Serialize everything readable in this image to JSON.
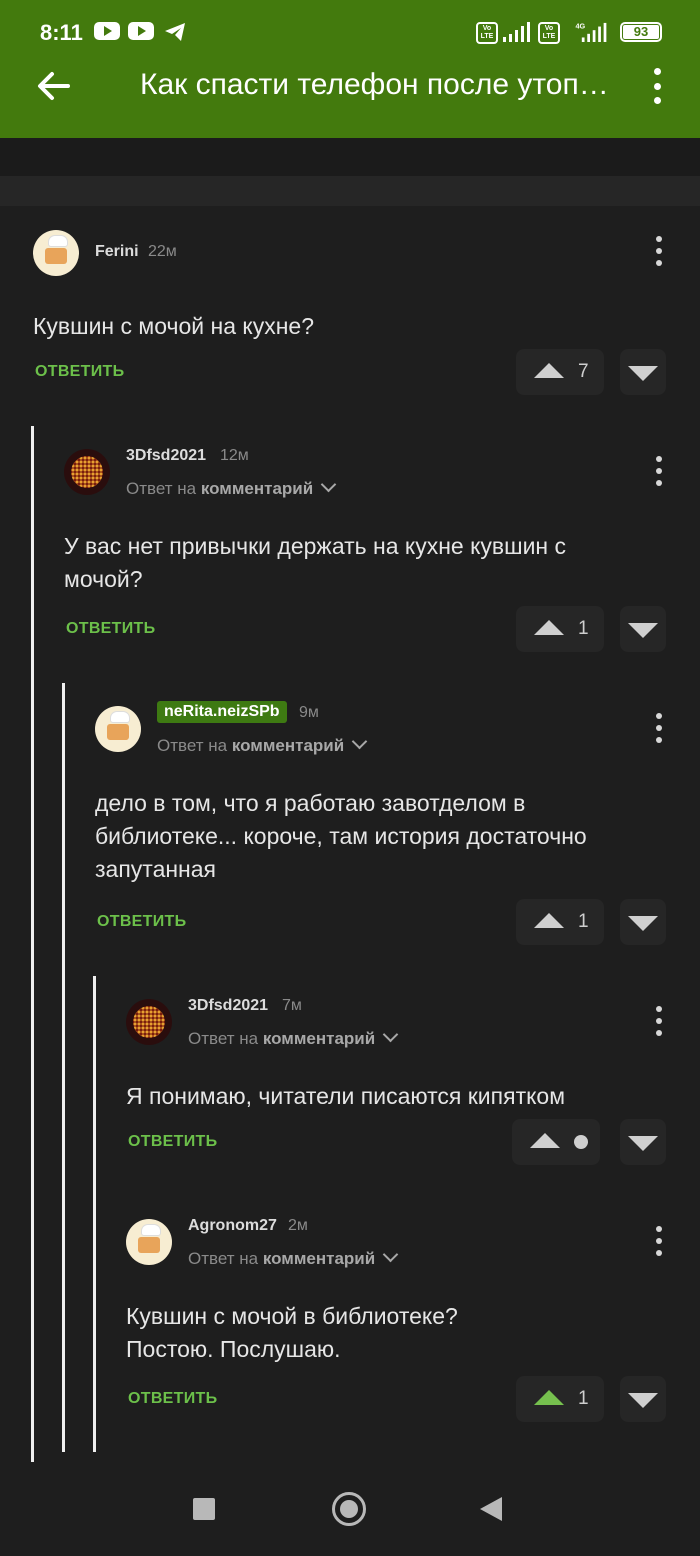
{
  "status_bar": {
    "time": "8:11",
    "icons": [
      "youtube-icon",
      "youtube-icon",
      "telegram-icon",
      "volte-icon",
      "signal-icon",
      "volte-icon",
      "signal-4g-icon"
    ],
    "volte_label": "Vo LTE",
    "network_label": "4G",
    "battery": "93"
  },
  "header": {
    "title": "Как спасти телефон после утопления",
    "back_icon": "arrow-left-icon",
    "menu_icon": "more-vertical-icon",
    "color": "#437a0d"
  },
  "comments": [
    {
      "author": "Ferini",
      "age": "22м",
      "text": "Кувшин с мочой на кухне?",
      "answer": "ОТВЕТИТЬ",
      "rating": "7",
      "avatar": "chef-avatar"
    },
    {
      "author": "3Dfsd2021",
      "age": "12м",
      "reply_prefix": "Ответ на",
      "reply_target": "комментарий",
      "text": "У вас нет привычки держать на кухне кувшин с мочой?",
      "answer": "ОТВЕТИТЬ",
      "rating": "1",
      "avatar": "grid-avatar"
    },
    {
      "author": "neRita.neizSPb",
      "age": "9м",
      "reply_prefix": "Ответ на",
      "reply_target": "комментарий",
      "text": "дело в том, что я работаю завотделом в библиотеке... короче, там история достаточно запутанная",
      "answer": "ОТВЕТИТЬ",
      "rating": "1",
      "avatar": "chef-avatar",
      "author_badge": true
    },
    {
      "author": "3Dfsd2021",
      "age": "7м",
      "reply_prefix": "Ответ на",
      "reply_target": "комментарий",
      "text": "Я понимаю, читатели писаются кипятком",
      "answer": "ОТВЕТИТЬ",
      "rating": "",
      "avatar": "grid-avatar"
    },
    {
      "author": "Agronom27",
      "age": "2м",
      "reply_prefix": "Ответ на",
      "reply_target": "комментарий",
      "text": "Кувшин с мочой в библиотеке?\nПостою. Послушаю.",
      "answer": "ОТВЕТИТЬ",
      "rating": "1",
      "avatar": "chef-avatar",
      "upvoted": true
    }
  ],
  "colors": {
    "accent_green": "#6cc04a",
    "upvote_active": "#76c04e",
    "background": "#1e1e1e"
  },
  "nav_bar": {
    "icons": [
      "recent-apps-icon",
      "home-icon",
      "back-icon"
    ]
  }
}
